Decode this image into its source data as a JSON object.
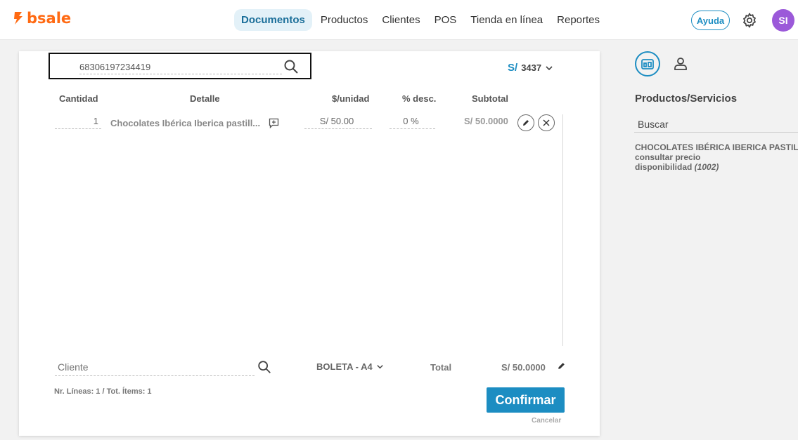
{
  "app": {
    "brand": "bsale",
    "brand_color": "#ff6a13",
    "accent": "#1c8dc2"
  },
  "nav": {
    "items": [
      {
        "label": "Documentos",
        "active": true
      },
      {
        "label": "Productos",
        "active": false
      },
      {
        "label": "Clientes",
        "active": false
      },
      {
        "label": "POS",
        "active": false
      },
      {
        "label": "Tienda en línea",
        "active": false
      },
      {
        "label": "Reportes",
        "active": false
      }
    ],
    "help_label": "Ayuda",
    "settings_icon": "gear-icon",
    "avatar_initials": "SI"
  },
  "document": {
    "search": {
      "value": "68306197234419"
    },
    "currency_symbol": "S/",
    "price_list": "3437",
    "columns": {
      "qty": "Cantidad",
      "detail": "Detalle",
      "unit": "$/unidad",
      "discount": "% desc.",
      "subtotal": "Subtotal"
    },
    "rows": [
      {
        "qty": "1",
        "detail": "Chocolates Ibérica Iberica pastill...",
        "unit_price": "S/ 50.00",
        "discount": "0 %",
        "subtotal": "S/ 50.0000"
      }
    ],
    "client_placeholder": "Cliente",
    "doc_type": "BOLETA - A4",
    "total_label": "Total",
    "total_value": "S/ 50.0000",
    "summary": "Nr. Líneas: 1 / Tot. Ítems: 1",
    "confirm_label": "Confirmar",
    "cancel_label": "Cancelar"
  },
  "side_panel": {
    "title": "Productos/Servicios",
    "search_placeholder": "Buscar",
    "product": {
      "name": "CHOCOLATES IBÉRICA IBERICA PASTILLAS",
      "price_label": "consultar precio",
      "availability_label": "disponibilidad",
      "availability_value": "(1002)"
    }
  }
}
